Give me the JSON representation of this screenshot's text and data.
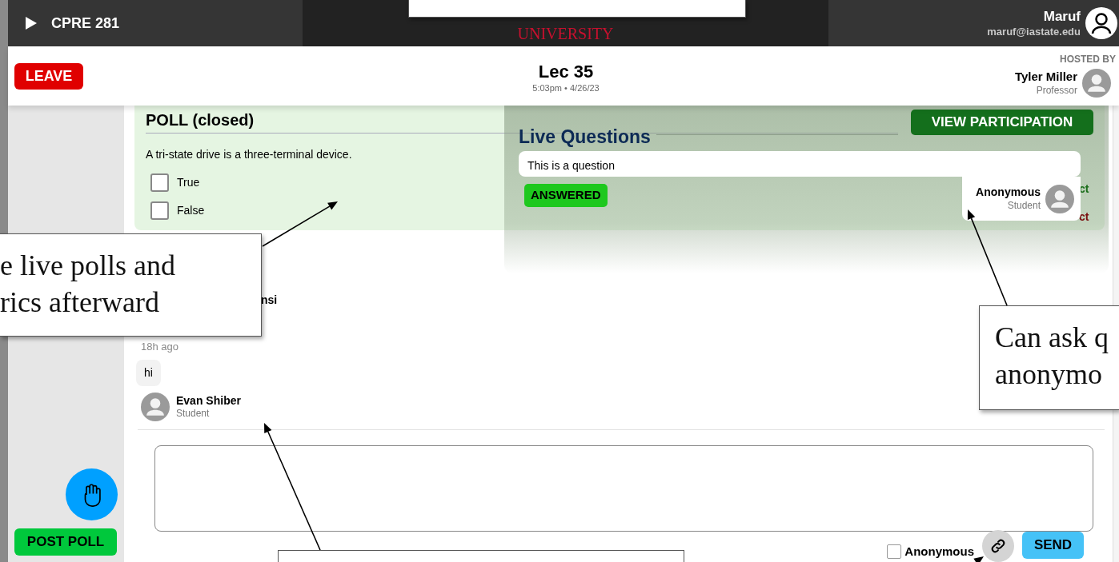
{
  "top_bar": {
    "course": "CPRE 281",
    "logo": "UNIVERSITY",
    "user": {
      "name": "Maruf",
      "email": "maruf@iastate.edu"
    }
  },
  "header": {
    "leave": "LEAVE",
    "title": "Lec 35",
    "subtitle": "5:03pm • 4/26/23",
    "hosted_by_label": "HOSTED BY",
    "host": {
      "name": "Tyler Miller",
      "role": "Professor"
    }
  },
  "sidebar": {
    "post_poll": "POST POLL"
  },
  "poll": {
    "title": "POLL (closed)",
    "question": "A tri-state drive is a three-terminal device.",
    "options": [
      {
        "label": "True",
        "checked": false
      },
      {
        "label": "False",
        "checked": false
      }
    ],
    "view_participation": "VIEW PARTICIPATION",
    "result_labels": [
      {
        "text": "ct",
        "color": "#1b6e1b"
      },
      {
        "text": "ct",
        "color": "#7a1010"
      }
    ]
  },
  "live_questions": {
    "title": "Live Questions",
    "questions": [
      {
        "text": "This is a question",
        "status": "ANSWERED",
        "author": "Anonymous",
        "role": "Student"
      }
    ]
  },
  "chat": {
    "partial_author": "nsi",
    "time": "18h ago",
    "message": "hi",
    "author": {
      "name": "Evan Shiber",
      "role": "Student"
    }
  },
  "composer": {
    "anonymous": {
      "label": "Anonymous",
      "checked": false
    },
    "send": "SEND"
  },
  "callouts": [
    {
      "text": "e live polls and\nrics afterward"
    },
    {
      "text": "Can ask q\nanonymo"
    }
  ]
}
